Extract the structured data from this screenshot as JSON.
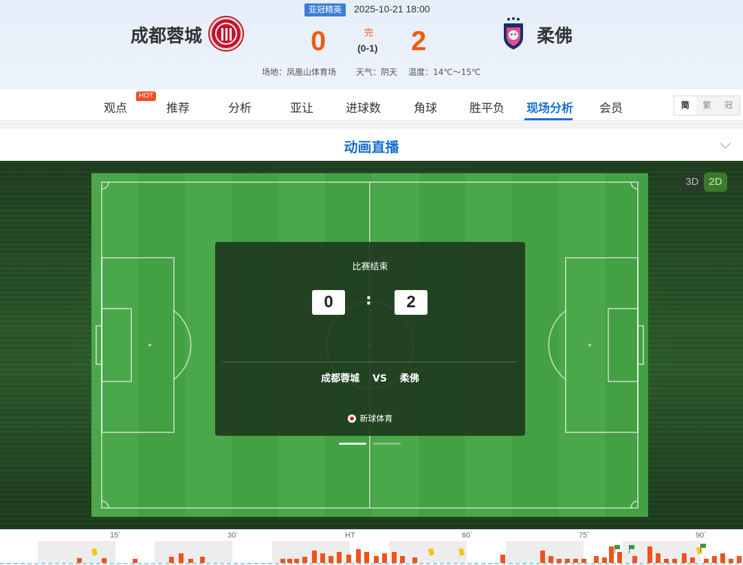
{
  "match": {
    "league": "亚冠精英",
    "datetime": "2025-10-21 18:00",
    "home_team": "成都蓉城",
    "away_team": "柔佛",
    "home_score": "0",
    "away_score": "2",
    "status": "完",
    "halftime": "(0-1)",
    "venue": "场地：凤凰山体育场",
    "weather": "天气：阴天",
    "temperature": "温度：14℃～15℃"
  },
  "nav": {
    "tabs": [
      "观点",
      "推荐",
      "分析",
      "亚让",
      "进球数",
      "角球",
      "胜平负",
      "现场分析",
      "会员"
    ],
    "active_tab": "现场分析",
    "hot_badge": "HOT",
    "lang_options": [
      "简",
      "繁",
      "冠"
    ],
    "active_lang": "简"
  },
  "section": {
    "title": "动画直播"
  },
  "animation": {
    "view_modes": [
      "3D",
      "2D"
    ],
    "active_view": "2D",
    "status_text": "比赛结束",
    "home_score": "0",
    "away_score": "2",
    "colon": ":",
    "home_team": "成都蓉城",
    "vs": "VS",
    "away_team": "柔佛",
    "brand": "新球体育"
  },
  "timeline": {
    "tick_labels": [
      "15`",
      "30`",
      "HT",
      "60`",
      "75`",
      "90`"
    ]
  },
  "colors": {
    "score": "#f05a14",
    "accent": "#1a6fce",
    "league_badge": "#3d7ed8",
    "hot": "#f04e23",
    "pitch_light": "#4aa74a",
    "pitch_dark": "#43a043"
  }
}
